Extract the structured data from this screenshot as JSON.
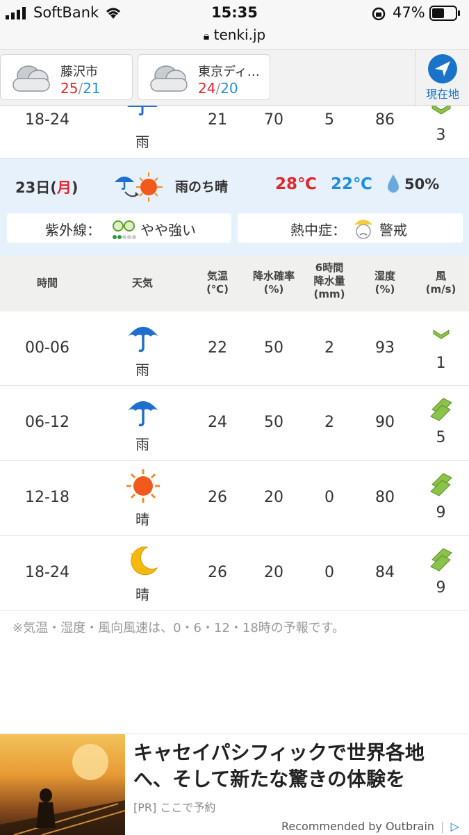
{
  "status_bar": {
    "carrier": "SoftBank",
    "time": "15:35",
    "battery": "47%",
    "url": "tenki.jp"
  },
  "locations": [
    {
      "name": "藤沢市",
      "high": "25",
      "low": "21"
    },
    {
      "name": "東京ディ…",
      "high": "24",
      "low": "20"
    }
  ],
  "current_location_label": "現在地",
  "prev_day_last_row": {
    "time": "18-24",
    "weather": "雨",
    "temp": "21",
    "precip_prob": "70",
    "precip_mm": "5",
    "humidity": "86",
    "wind": "3"
  },
  "day_summary": {
    "date": "23日",
    "weekday_open": "(",
    "weekday": "月",
    "weekday_close": ")",
    "weather": "雨のち晴",
    "high": "28℃",
    "low": "22℃",
    "precip": "50%",
    "uv_label": "紫外線：",
    "uv_value": "やや強い",
    "heat_label": "熱中症：",
    "heat_value": "警戒"
  },
  "table_header": {
    "time": "時間",
    "weather": "天気",
    "temp_1": "気温",
    "temp_2": "(℃)",
    "prob_1": "降水確率",
    "prob_2": "(%)",
    "prec_1": "6時間",
    "prec_2": "降水量",
    "prec_3": "(mm)",
    "hum_1": "湿度",
    "hum_2": "(%)",
    "wind_1": "風",
    "wind_2": "(m/s)"
  },
  "rows": [
    {
      "time": "00-06",
      "weather": "雨",
      "icon": "umbrella-icon",
      "temp": "22",
      "precip_prob": "50",
      "precip_mm": "2",
      "humidity": "93",
      "wind": "1"
    },
    {
      "time": "06-12",
      "weather": "雨",
      "icon": "umbrella-icon",
      "temp": "24",
      "precip_prob": "50",
      "precip_mm": "2",
      "humidity": "90",
      "wind": "5"
    },
    {
      "time": "12-18",
      "weather": "晴",
      "icon": "sun-icon",
      "temp": "26",
      "precip_prob": "20",
      "precip_mm": "0",
      "humidity": "80",
      "wind": "9"
    },
    {
      "time": "18-24",
      "weather": "晴",
      "icon": "moon-icon",
      "temp": "26",
      "precip_prob": "20",
      "precip_mm": "0",
      "humidity": "84",
      "wind": "9"
    }
  ],
  "note": "※気温・湿度・風向風速は、0・6・12・18時の予報です。",
  "ad": {
    "headline": "キャセイパシフィックで世界各地へ、そして新たな驚きの体験を",
    "pr_tag": "[PR]",
    "cta": "ここで予約",
    "recommended_by": "Recommended by Outbrain"
  },
  "colors": {
    "high": "#e2242b",
    "low": "#1f8ee0",
    "accent": "#1a73c9",
    "summary_bg": "#e7f1fb",
    "wind_green": "#8bc34a"
  }
}
